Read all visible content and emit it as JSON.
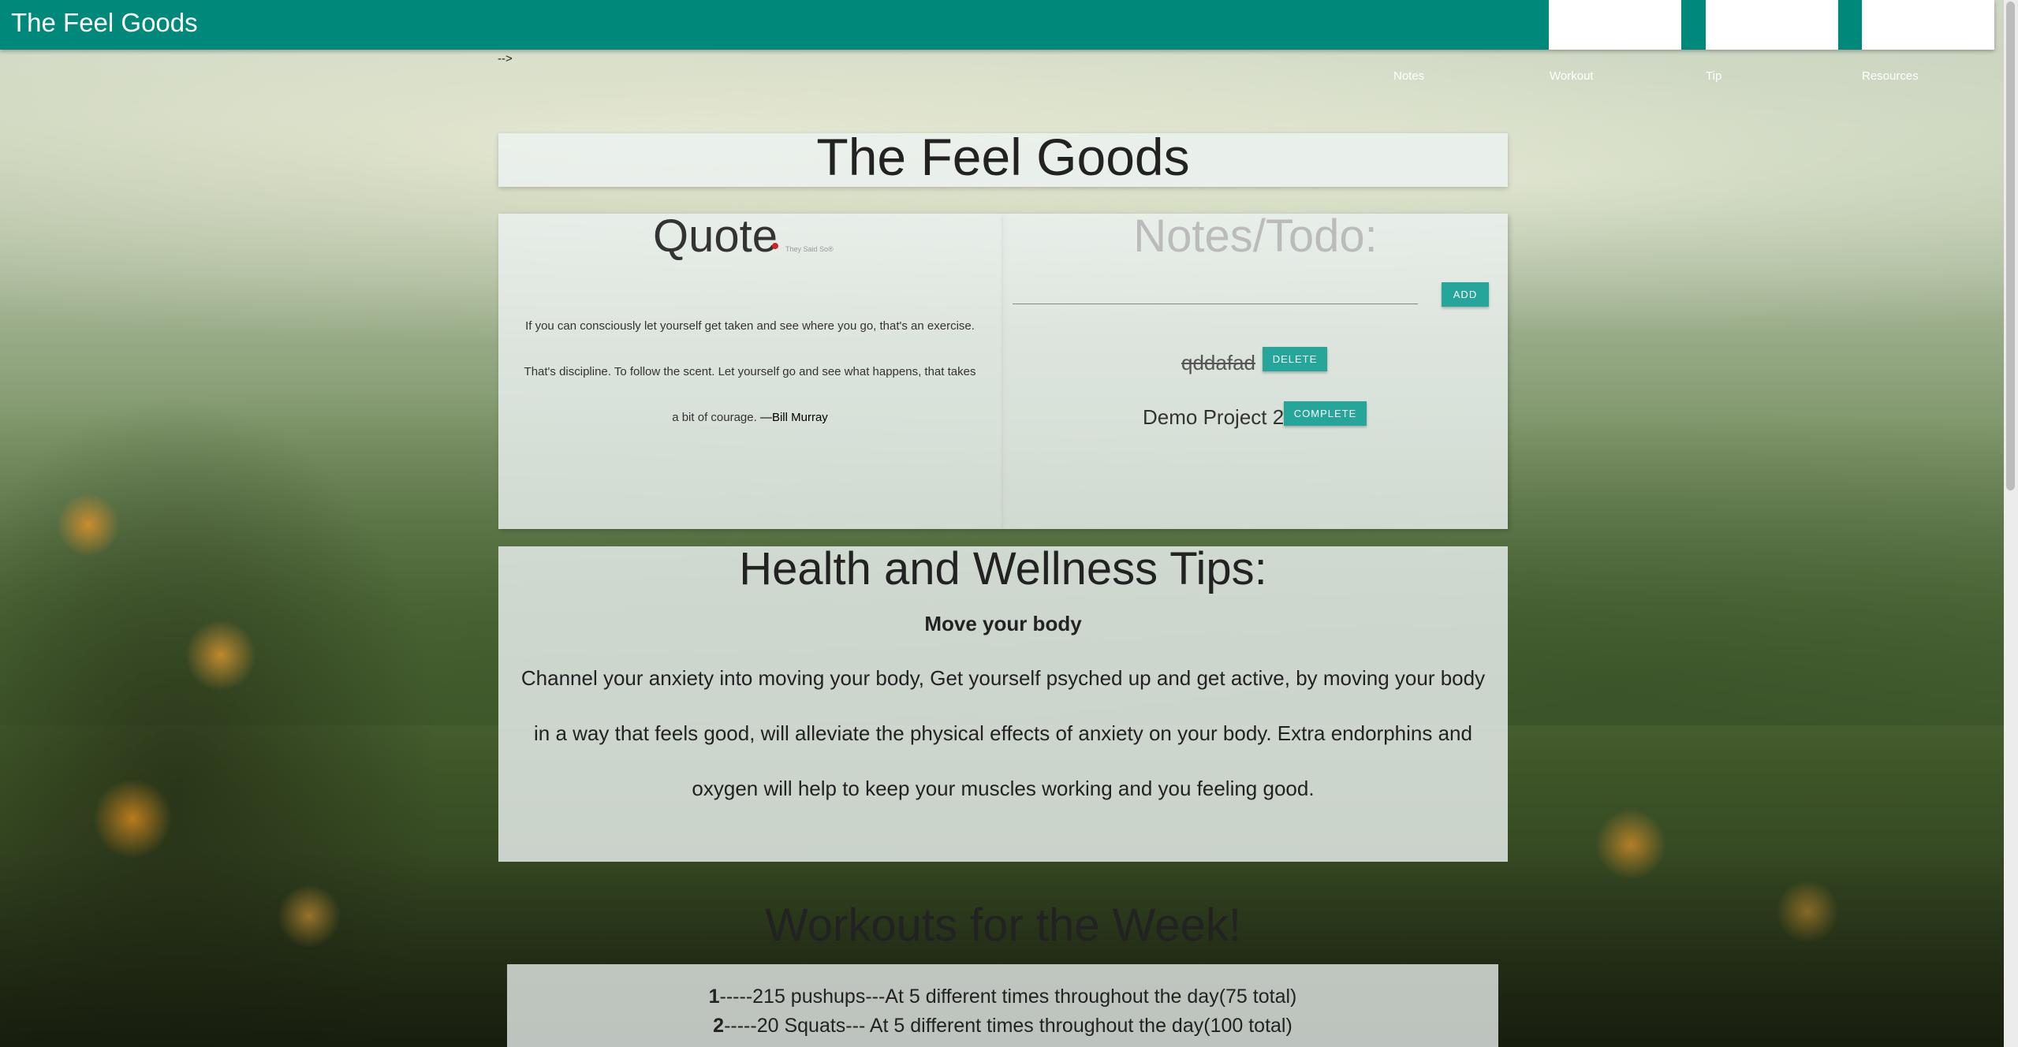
{
  "app": {
    "brand": "The Feel Goods",
    "stray_text": "-->"
  },
  "nav": {
    "items": [
      "Notes",
      "Workout",
      "Tip",
      "Resources"
    ]
  },
  "hero": {
    "title": "The Feel Goods"
  },
  "quote": {
    "heading": "Quote",
    "credit": "They Said So®",
    "text": "If you can consciously let yourself get taken and see where you go, that's an exercise. That's discipline. To follow the scent. Let yourself go and see what happens, that takes a bit of courage.",
    "author": "—Bill Murray"
  },
  "notes": {
    "heading": "Notes/Todo:",
    "input_value": "",
    "add_label": "ADD",
    "items": [
      {
        "text": "qddafad",
        "completed": true,
        "action_label": "DELETE"
      },
      {
        "text": "Demo Project 2",
        "completed": false,
        "action_label": "COMPLETE"
      }
    ]
  },
  "health": {
    "heading": "Health and Wellness Tips:",
    "subheading": "Move your body",
    "text": "Channel your anxiety into moving your body, Get yourself psyched up and get active, by moving your body in a way that feels good, will alleviate the physical effects of anxiety on your body. Extra endorphins and oxygen will help to keep your muscles working and you feeling good."
  },
  "workouts": {
    "heading": "Workouts for the Week!",
    "items": [
      {
        "num": "1",
        "text": "-----215 pushups---At 5 different times throughout the day(75 total)"
      },
      {
        "num": "2",
        "text": "-----20 Squats--- At 5 different times throughout the day(100 total)"
      }
    ]
  },
  "colors": {
    "topbar": "#00897b",
    "button": "#26a69a"
  }
}
